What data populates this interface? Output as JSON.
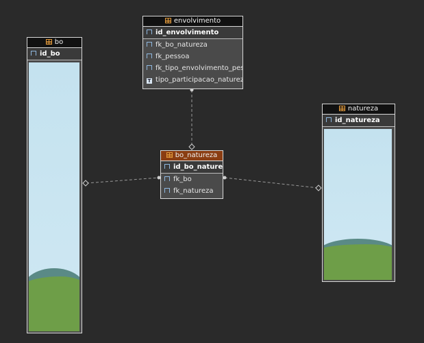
{
  "tables": {
    "envolvimento": {
      "title": "envolvimento",
      "pk": "id_envolvimento",
      "columns": [
        "fk_bo_natureza",
        "fk_pessoa",
        "fk_tipo_envolvimento_pessoa",
        "tipo_participacao_natureza"
      ]
    },
    "bo": {
      "title": "bo",
      "pk": "id_bo"
    },
    "bo_natureza": {
      "title": "bo_natureza",
      "pk": "id_bo_natureza",
      "columns": [
        "fk_bo",
        "fk_natureza"
      ]
    },
    "natureza": {
      "title": "natureza",
      "pk": "id_natureza"
    }
  },
  "colors": {
    "background": "#2a2a2a",
    "header": "#111111",
    "relation_header": "#8a3d12",
    "row": "#4a4a4a"
  },
  "icons": [
    "table-icon",
    "key-icon",
    "type-icon"
  ]
}
